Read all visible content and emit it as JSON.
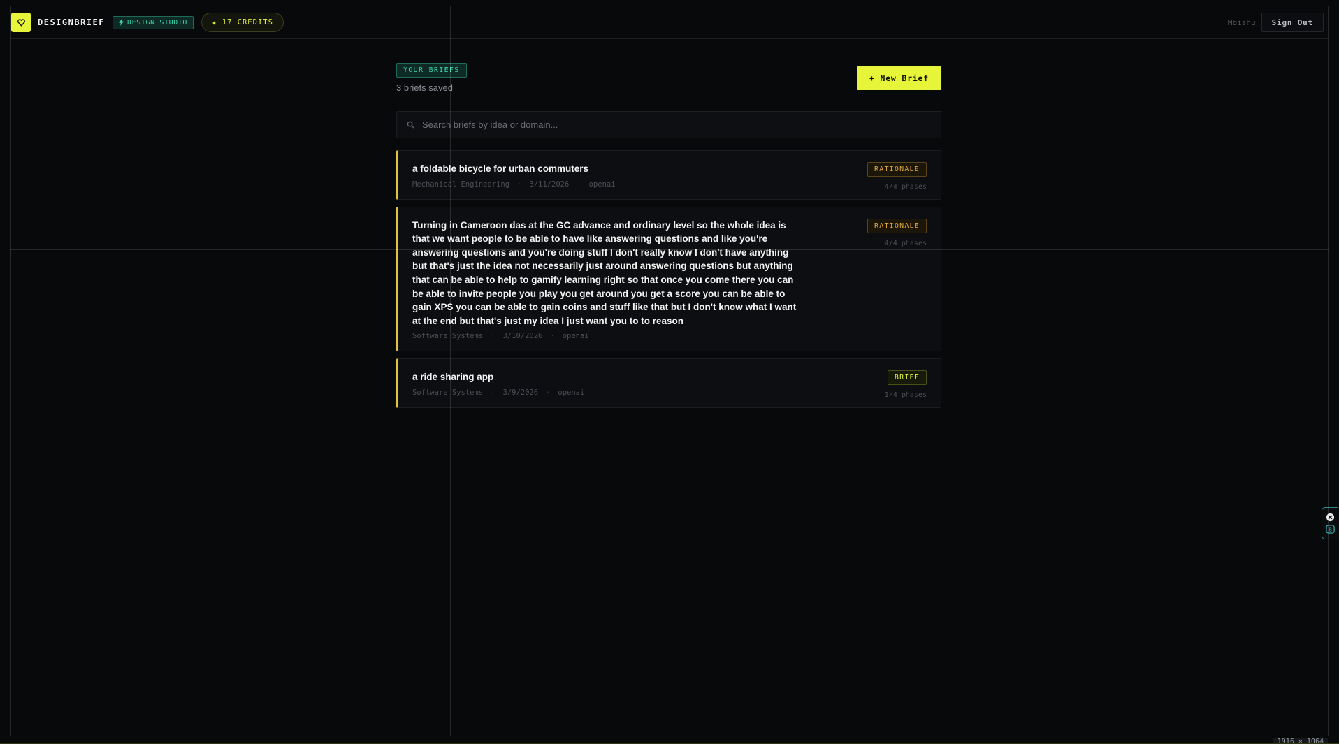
{
  "app": {
    "name": "DESIGNBRIEF",
    "logo_icon": "heart-icon",
    "studio_label": "DESIGN STUDIO",
    "credits_label": "17 CREDITS"
  },
  "header": {
    "username": "Mbishu",
    "sign_out_label": "Sign Out"
  },
  "main": {
    "section_label": "YOUR BRIEFS",
    "saved_count": "3 briefs saved",
    "new_brief_label": "+ New Brief",
    "search_placeholder": "Search briefs by idea or domain..."
  },
  "briefs": [
    {
      "title": "a foldable bicycle for urban commuters",
      "domain": "Mechanical Engineering",
      "date": "3/11/2026",
      "model": "openai",
      "status": "RATIONALE",
      "phases": "4/4 phases"
    },
    {
      "title": "Turning in Cameroon das at the GC advance and ordinary level so the whole idea is that we want people to be able to have like answering questions and like you're answering questions and you're doing stuff I don't really know I don't have anything but that's just the idea not necessarily just around answering questions but anything that can be able to help to gamify learning right so that once you come there you can be able to invite people you play you get around you get a score you can be able to gain XPS you can be able to gain coins and stuff like that but I don't know what I want at the end but that's just my idea I just want you to to reason",
      "domain": "Software Systems",
      "date": "3/10/2026",
      "model": "openai",
      "status": "RATIONALE",
      "phases": "4/4 phases"
    },
    {
      "title": "a ride sharing app",
      "domain": "Software Systems",
      "date": "3/9/2026",
      "model": "openai",
      "status": "BRIEF",
      "phases": "1/4 phases"
    }
  ],
  "overlay": {
    "size_readout": "1916 × 1064"
  },
  "colors": {
    "background": "#08090b",
    "accent": "#e6f53a",
    "teal": "#39d8b0",
    "rationale": "#e0a83a",
    "card_border_left": "#e0c43a"
  }
}
